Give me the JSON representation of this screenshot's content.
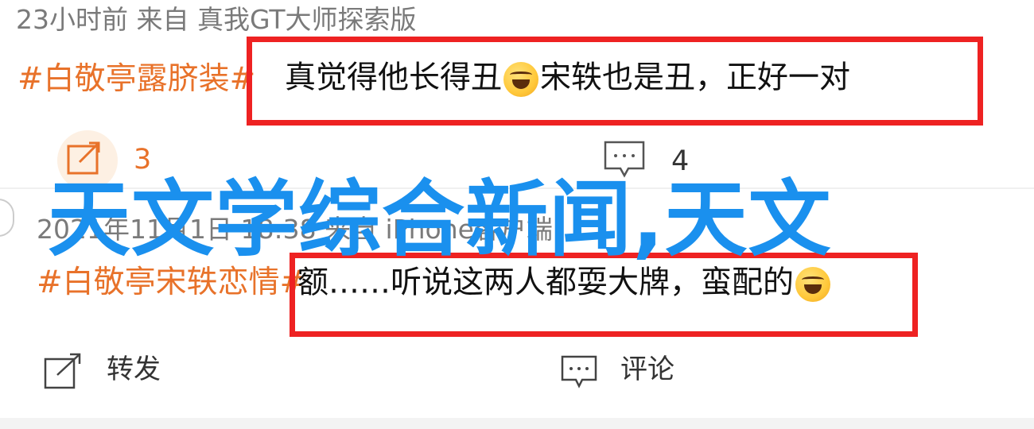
{
  "post1": {
    "meta": "23小时前 来自 真我GT大师探索版",
    "topic": "#白敬亭露脐装#",
    "text_before_emoji": "真觉得他长得丑",
    "emoji": "crying-laughing-emoji",
    "text_after_emoji": "宋轶也是丑，正好一对",
    "repost_count": "3",
    "comment_count": "4"
  },
  "post2": {
    "meta": "2021年11月1日 18:38 来自 iPhone客户端",
    "topic": "#白敬亭宋轶恋情#",
    "text_before_emoji": "额……听说这两人都耍大牌，蛮配的",
    "emoji": "laughing-emoji",
    "repost_label": "转发",
    "comment_label": "评论"
  },
  "overlay": {
    "title": "天文学综合新闻,天文"
  },
  "colors": {
    "topic": "#e8722a",
    "highlight_border": "#ee2222",
    "overlay_text": "#1a90ee",
    "meta": "#7a7a7a"
  }
}
